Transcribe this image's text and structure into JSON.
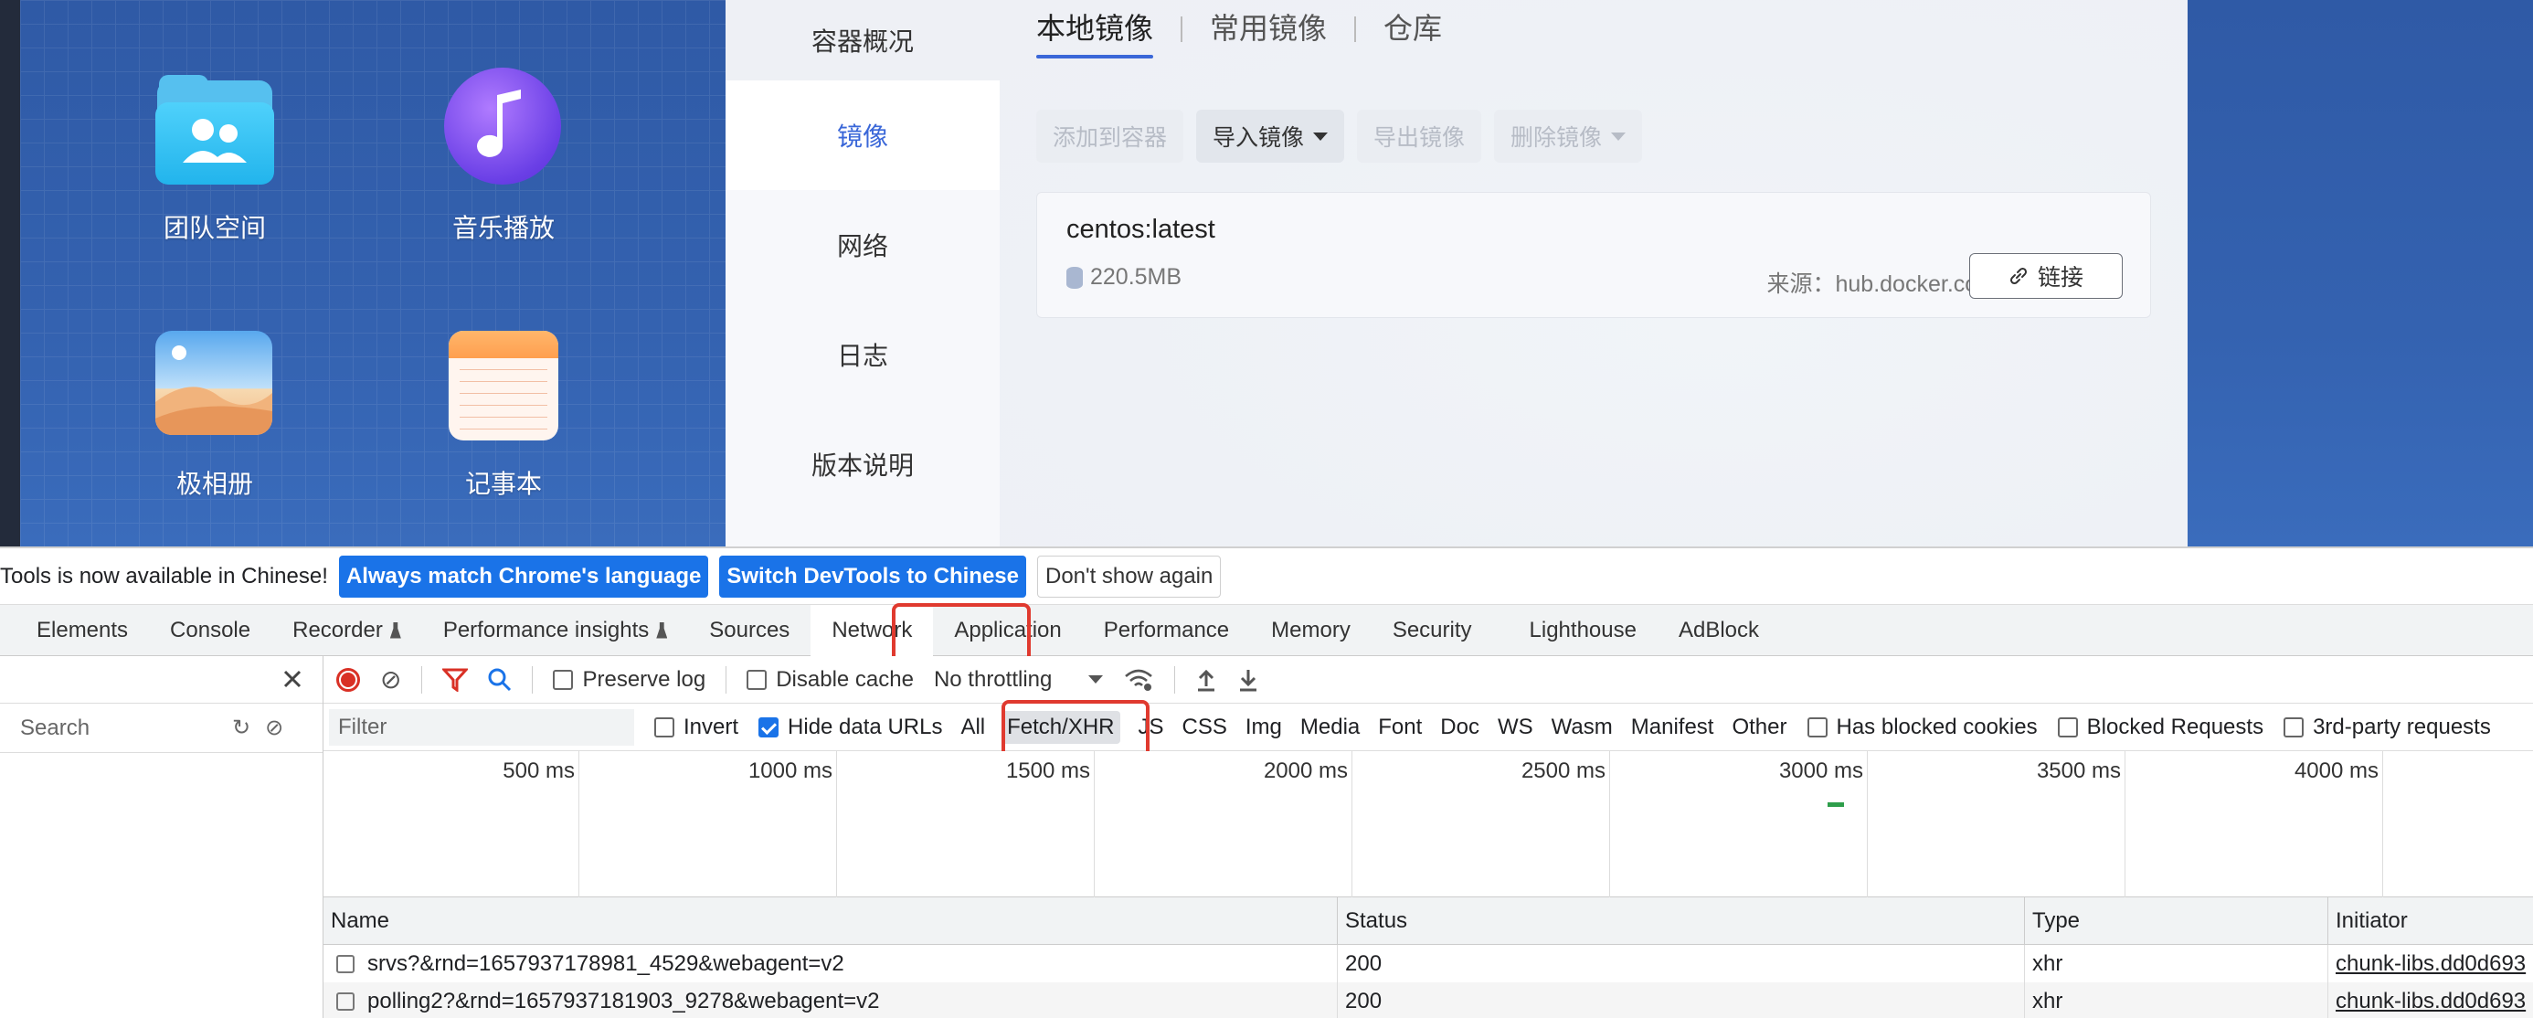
{
  "desktop": {
    "icons": [
      {
        "label": "团队空间"
      },
      {
        "label": "音乐播放"
      },
      {
        "label": "极相册"
      },
      {
        "label": "记事本"
      }
    ]
  },
  "docker": {
    "nav": [
      "容器概况",
      "镜像",
      "网络",
      "日志",
      "版本说明"
    ],
    "active_nav": "镜像",
    "tabs": [
      "本地镜像",
      "常用镜像",
      "仓库"
    ],
    "active_tab": "本地镜像",
    "toolbar": {
      "add_to_container": "添加到容器",
      "import_image": "导入镜像",
      "export_image": "导出镜像",
      "delete_image": "删除镜像"
    },
    "image": {
      "name": "centos:latest",
      "size": "220.5MB",
      "source": "来源：hub.docker.com",
      "link_label": "链接"
    },
    "accent": "#3a67d8"
  },
  "devtools": {
    "infobar": {
      "message": "Tools is now available in Chinese!",
      "btn_match": "Always match Chrome's language",
      "btn_switch": "Switch DevTools to Chinese",
      "btn_dismiss": "Don't show again"
    },
    "tabs": [
      "Elements",
      "Console",
      "Recorder",
      "Performance insights",
      "Sources",
      "Network",
      "Application",
      "Performance",
      "Memory",
      "Security",
      "Lighthouse",
      "AdBlock"
    ],
    "active_tab": "Network",
    "sidebar": {
      "search_placeholder": "Search"
    },
    "toolbar": {
      "preserve_log": "Preserve log",
      "disable_cache": "Disable cache",
      "throttling": "No throttling"
    },
    "filter": {
      "placeholder": "Filter",
      "invert": "Invert",
      "hide_data_urls": "Hide data URLs",
      "types": [
        "All",
        "Fetch/XHR",
        "JS",
        "CSS",
        "Img",
        "Media",
        "Font",
        "Doc",
        "WS",
        "Wasm",
        "Manifest",
        "Other"
      ],
      "selected_type": "Fetch/XHR",
      "has_blocked_cookies": "Has blocked cookies",
      "blocked_requests": "Blocked Requests",
      "third_party": "3rd-party requests"
    },
    "timeline_labels": [
      "500 ms",
      "1000 ms",
      "1500 ms",
      "2000 ms",
      "2500 ms",
      "3000 ms",
      "3500 ms",
      "4000 ms"
    ],
    "table": {
      "columns": [
        "Name",
        "Status",
        "Type",
        "Initiator"
      ],
      "rows": [
        {
          "name": "srvs?&rnd=1657937178981_4529&webagent=v2",
          "status": "200",
          "type": "xhr",
          "initiator": "chunk-libs.dd0d693"
        },
        {
          "name": "polling2?&rnd=1657937181903_9278&webagent=v2",
          "status": "200",
          "type": "xhr",
          "initiator": "chunk-libs.dd0d693"
        }
      ]
    },
    "highlight_color": "#e03a2f"
  }
}
